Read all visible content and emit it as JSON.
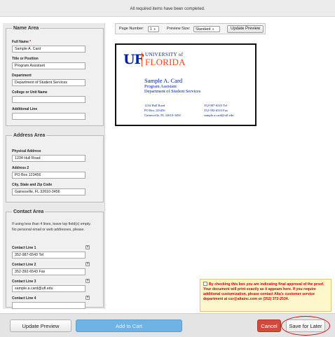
{
  "status": {
    "message": "All required items have been completed."
  },
  "name_area": {
    "legend": "Name Area",
    "full_name_label": "Full Name",
    "required_marker": "*",
    "full_name": "Sample A. Card",
    "title_label": "Title or Position",
    "title": "Program Assistant",
    "department_label": "Department",
    "department": "Department of Student Services",
    "college_label": "College or Unit Name",
    "college": "",
    "additional_label": "Additional Line",
    "additional": ""
  },
  "address_area": {
    "legend": "Address Area",
    "physical_label": "Physical Address",
    "physical": "1234 Hull Road",
    "address2_label": "Address 2",
    "address2": "PO Box 123456",
    "city_label": "City, State and Zip Code",
    "city": "Gainesville, FL 32610-3456"
  },
  "contact_area": {
    "legend": "Contact Area",
    "note": "If using less than 4 lines, leave top field(s) empty. No personal email or web addresses, please.",
    "help_glyph": "?",
    "lines": [
      {
        "label": "Contact Line 1",
        "value": "352-987-6543 Tel"
      },
      {
        "label": "Contact Line 2",
        "value": "352-392-6543 Fax"
      },
      {
        "label": "Contact Line 3",
        "value": "sample.a.card@ufl.edu"
      },
      {
        "label": "Contact Line 4",
        "value": ""
      }
    ]
  },
  "toolbar": {
    "page_number_label": "Page Number:",
    "page_number": "1",
    "preview_size_label": "Preview Size:",
    "preview_size": "Standard",
    "update_label": "Update Preview",
    "dropdown_icon": "updown-arrows-icon"
  },
  "card": {
    "logo_mark": "UF",
    "logo_university": "UNIVERSITY of",
    "logo_florida": "FLORIDA",
    "name": "Sample A. Card",
    "title": "Program Assistant",
    "department": "Department of Student Services",
    "address_lines": [
      "1234 Hull Road",
      "PO Box 123456",
      "Gainesville, FL 32610-3456"
    ],
    "contact_lines": [
      "352-987-6543 Tel",
      "352-392-6543 Fax",
      "sample.a.card@ufl.edu"
    ],
    "colors": {
      "blue": "#0021a5",
      "orange": "#fa4616"
    }
  },
  "approval": {
    "text": "By checking this box you are indicating final approval of the proof. Your document will print exactly as it appears here. If you require additional customization, please contact Alta's customer service department at csr@altainc.com or (352) 372-2534."
  },
  "footer": {
    "update_label": "Update Preview",
    "cart_label": "Add to Cart",
    "cancel_label": "Cancel",
    "save_label": "Save for Later"
  },
  "colors": {
    "cart_blue": "#6fb3e4",
    "cancel_red": "#d24a3c",
    "warning_red": "#d00000"
  }
}
